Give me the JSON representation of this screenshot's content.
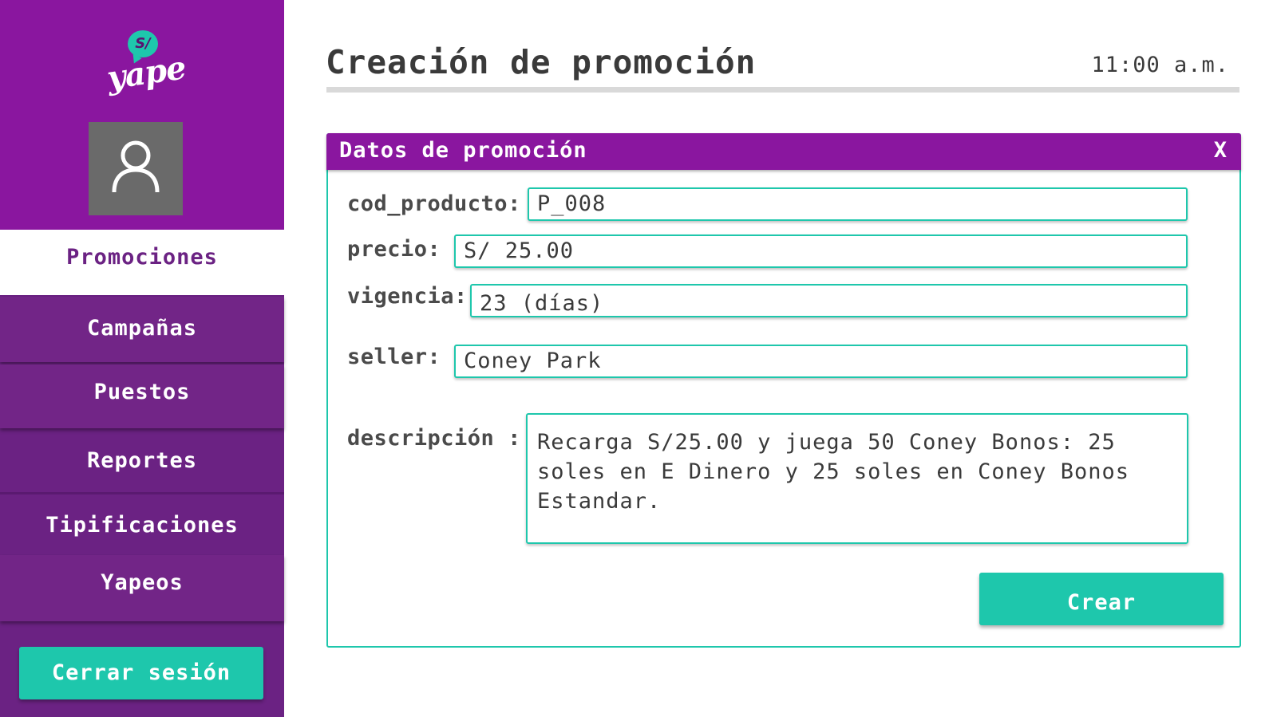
{
  "app": {
    "logo_symbol": "S/",
    "logo_text": "yape"
  },
  "sidebar": {
    "items": [
      {
        "label": "Promociones",
        "active": true
      },
      {
        "label": "Campañas"
      },
      {
        "label": "Puestos"
      },
      {
        "label": "Reportes"
      },
      {
        "label": "Tipificaciones"
      },
      {
        "label": "Yapeos"
      }
    ],
    "logout_label": "Cerrar sesión"
  },
  "header": {
    "title": "Creación de promoción",
    "time": "11:00 a.m."
  },
  "form": {
    "title": "Datos de promoción",
    "close_label": "X",
    "fields": {
      "cod_producto": {
        "label": "cod_producto:",
        "value": "P_008"
      },
      "precio": {
        "label": "precio:",
        "value": "S/ 25.00"
      },
      "vigencia": {
        "label": "vigencia:",
        "value": "23 (días)"
      },
      "seller": {
        "label": "seller:",
        "value": "Coney Park"
      },
      "descripcion": {
        "label": "descripción :",
        "value": "Recarga S/25.00 y juega 50 Coney Bonos: 25 soles en E Dinero y 25 soles en Coney Bonos Estandar."
      }
    },
    "submit_label": "Crear"
  },
  "colors": {
    "brand_purple": "#8a169f",
    "sidebar_purple": "#6b2283",
    "accent_teal": "#1ec7ac"
  }
}
